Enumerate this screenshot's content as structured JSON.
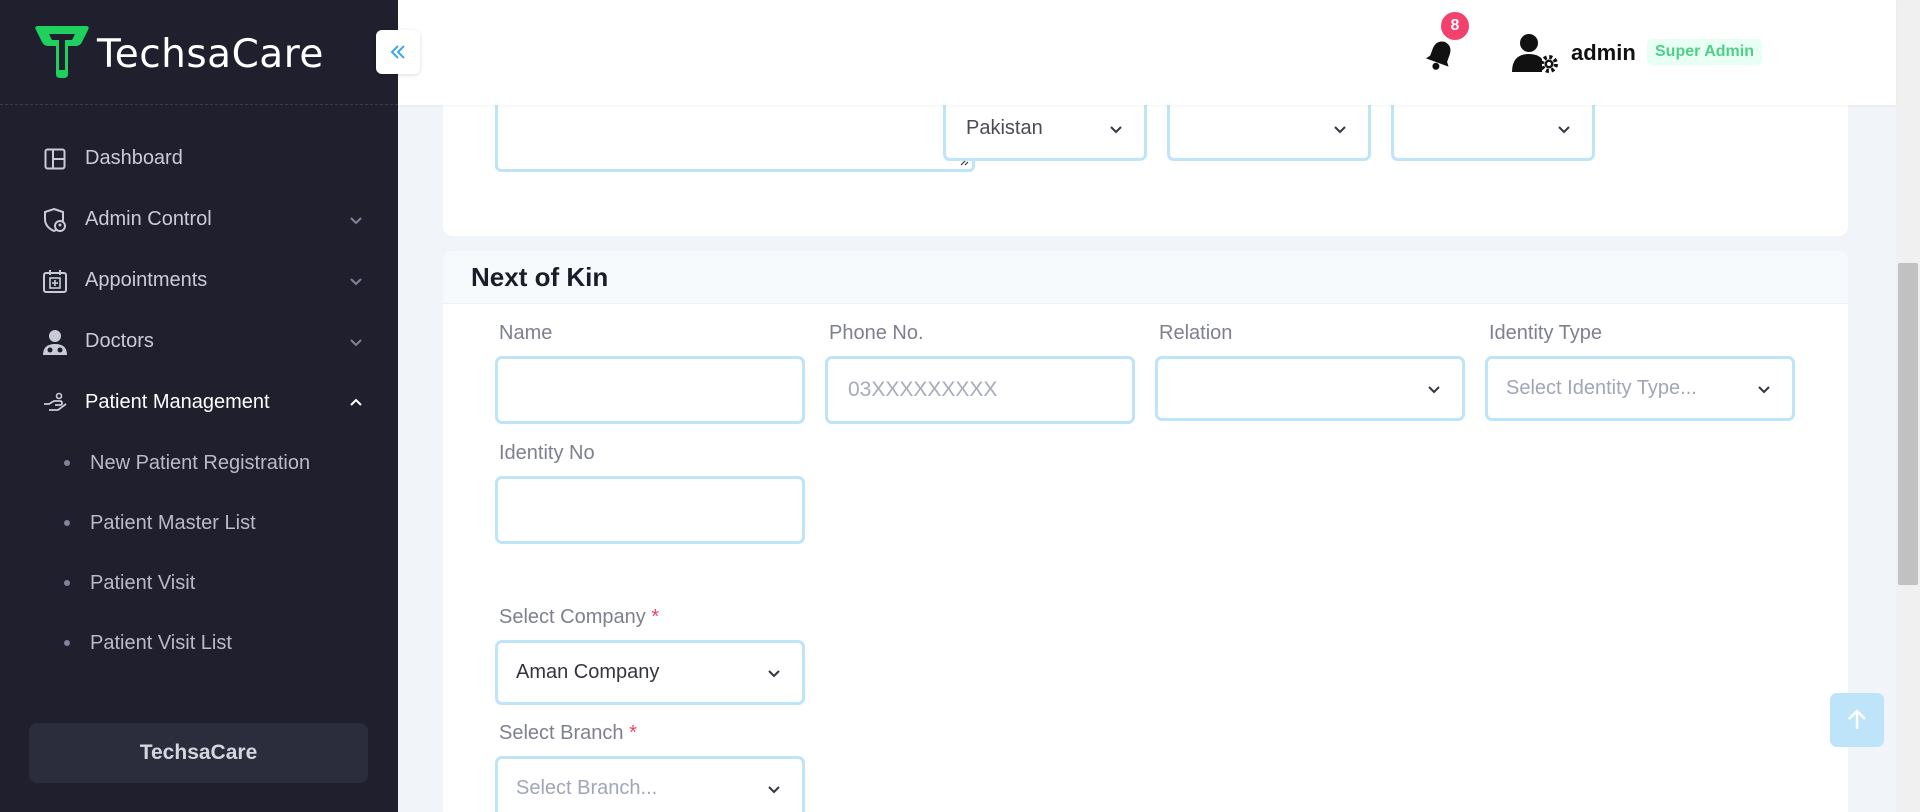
{
  "brand": {
    "name": "TechsaCare"
  },
  "header": {
    "notification_count": "8",
    "user_name": "admin",
    "user_role": "Super Admin"
  },
  "sidebar": {
    "items": [
      {
        "label": "Dashboard"
      },
      {
        "label": "Admin Control"
      },
      {
        "label": "Appointments"
      },
      {
        "label": "Doctors"
      },
      {
        "label": "Patient Management"
      }
    ],
    "sub_items": [
      {
        "label": "New Patient Registration"
      },
      {
        "label": "Patient Master List"
      },
      {
        "label": "Patient Visit"
      },
      {
        "label": "Patient Visit List"
      }
    ],
    "footer": "TechsaCare"
  },
  "address": {
    "country_value": "Pakistan"
  },
  "next_of_kin": {
    "title": "Next of Kin",
    "name_label": "Name",
    "phone_label": "Phone No.",
    "phone_placeholder": "03XXXXXXXXX",
    "relation_label": "Relation",
    "identity_type_label": "Identity Type",
    "identity_type_placeholder": "Select Identity Type...",
    "identity_no_label": "Identity No",
    "company_label": "Select Company",
    "company_value": "Aman Company",
    "branch_label": "Select Branch",
    "branch_placeholder": "Select Branch...",
    "required_mark": "*"
  },
  "colors": {
    "sidebar_bg": "#1f1f2d",
    "accent": "#bde4f9",
    "badge": "#f1416c",
    "role": "#50cd89"
  }
}
